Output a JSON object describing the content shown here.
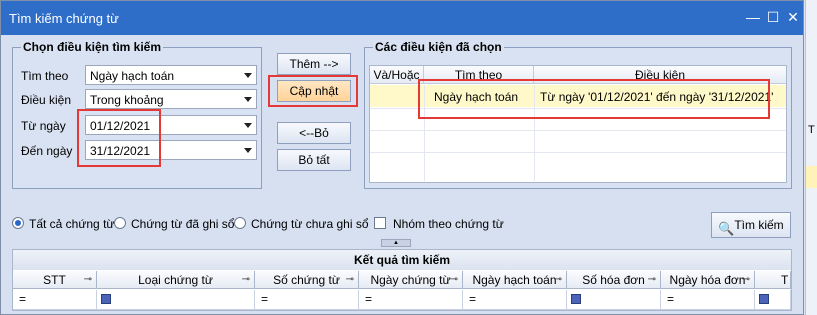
{
  "window": {
    "title": "Tìm kiếm chứng từ",
    "minimize": "—",
    "maximize": "☐",
    "close": "✕"
  },
  "filter": {
    "group_title": "Chọn điều kiện tìm kiếm",
    "search_by_label": "Tìm theo",
    "search_by_value": "Ngày hạch toán",
    "condition_label": "Điều kiện",
    "condition_value": "Trong khoảng",
    "from_label": "Từ ngày",
    "from_value": "01/12/2021",
    "to_label": "Đến ngày",
    "to_value": "31/12/2021"
  },
  "buttons": {
    "add": "Thêm -->",
    "update": "Cập nhật",
    "remove": "<--Bỏ",
    "clear_all": "Bỏ tất",
    "search": "Tìm kiếm"
  },
  "selected": {
    "group_title": "Các điều kiện đã chọn",
    "columns": [
      "Và/Hoặc",
      "Tìm theo",
      "Điều kiện"
    ],
    "rows": [
      {
        "and_or": "",
        "field": "Ngày hạch toán",
        "condition": "Từ ngày '01/12/2021' đến ngày '31/12/2021'"
      }
    ]
  },
  "options": {
    "all_docs": "Tất cả chứng từ",
    "posted_docs": "Chứng từ đã ghi sổ",
    "unposted_docs": "Chứng từ chưa ghi sổ",
    "group_by_doc": "Nhóm theo chứng từ",
    "selected_option": "all_docs"
  },
  "results": {
    "title": "Kết quả tìm kiếm",
    "columns": [
      "STT",
      "Loại chứng từ",
      "Số chứng từ",
      "Ngày chứng từ",
      "Ngày hạch toán",
      "Số hóa đơn",
      "Ngày hóa đơn",
      "T"
    ],
    "filter_row_symbol": "="
  },
  "right_edge": {
    "letter_t": "T"
  },
  "colors": {
    "highlight_row": "#fff8c8",
    "accent_red": "#e53935",
    "title_bar": "#2f6ec8"
  }
}
